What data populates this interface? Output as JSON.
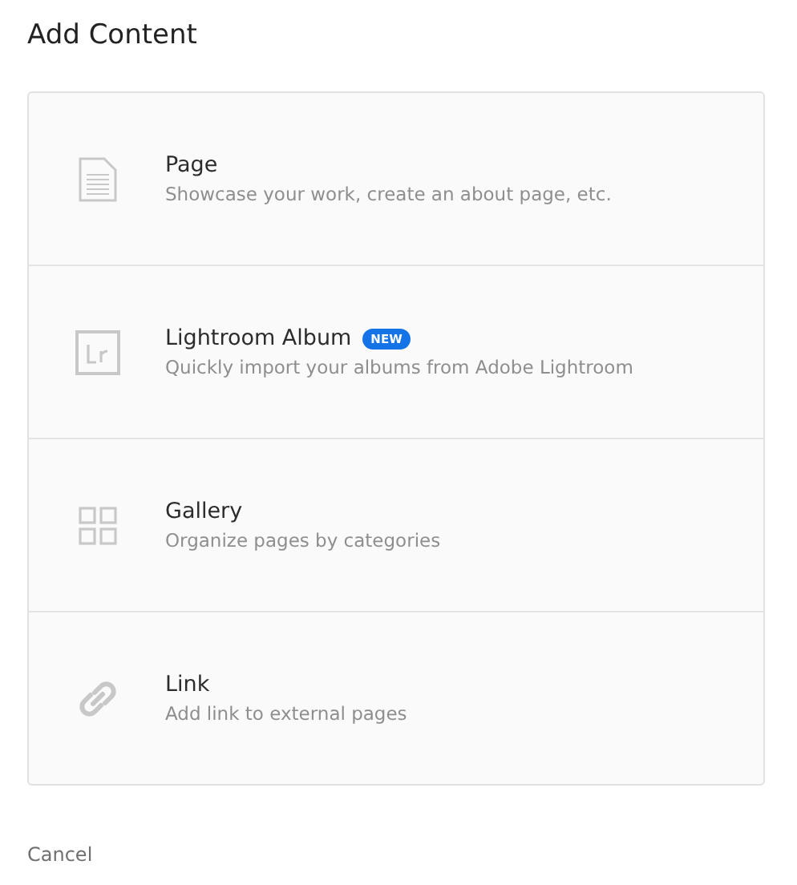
{
  "title": "Add Content",
  "options": [
    {
      "kind": "page",
      "label": "Page",
      "description": "Showcase your work, create an about page, etc."
    },
    {
      "kind": "lightroom",
      "label": "Lightroom Album",
      "badge": "NEW",
      "description": "Quickly import your albums from Adobe Lightroom"
    },
    {
      "kind": "gallery",
      "label": "Gallery",
      "description": "Organize pages by categories"
    },
    {
      "kind": "link",
      "label": "Link",
      "description": "Add link to external pages"
    }
  ],
  "cancel": "Cancel"
}
